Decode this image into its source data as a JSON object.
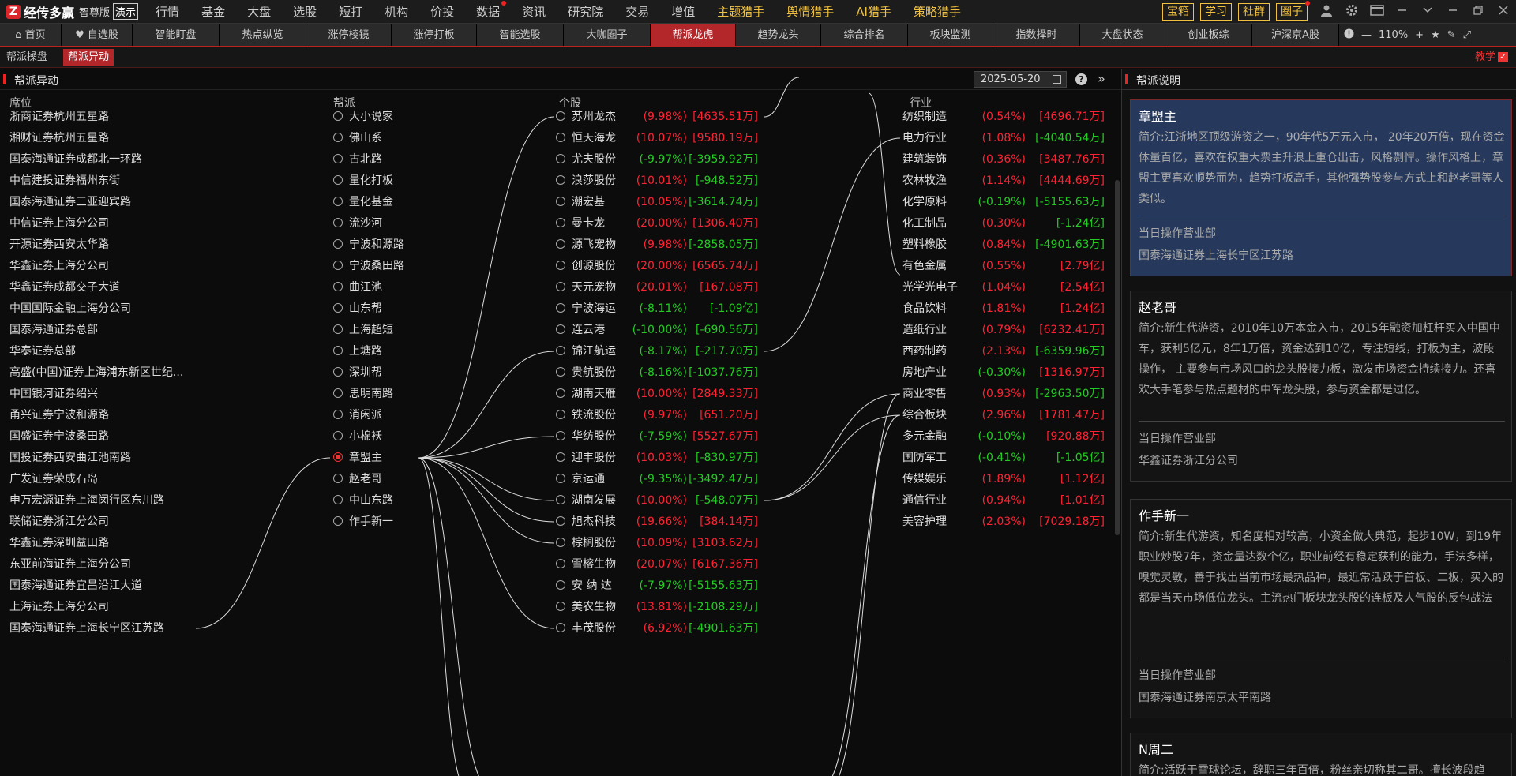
{
  "app": {
    "logo_glyph": "Z",
    "name": "经传多赢",
    "edition": "智尊版",
    "demo": "演示"
  },
  "main_nav": [
    {
      "label": "行情"
    },
    {
      "label": "基金"
    },
    {
      "label": "大盘"
    },
    {
      "label": "选股"
    },
    {
      "label": "短打"
    },
    {
      "label": "机构"
    },
    {
      "label": "价投"
    },
    {
      "label": "数据",
      "dot": true
    },
    {
      "label": "资讯"
    },
    {
      "label": "研究院"
    },
    {
      "label": "交易"
    },
    {
      "label": "增值"
    },
    {
      "label": "主题猎手",
      "hl": true
    },
    {
      "label": "舆情猎手",
      "hl": true
    },
    {
      "label": "AI猎手",
      "hl": true
    },
    {
      "label": "策略猎手",
      "hl": true
    }
  ],
  "toolbar": {
    "buttons": [
      "宝箱",
      "学习",
      "社群",
      "圈子"
    ],
    "icons": [
      "user-icon",
      "gear-icon",
      "window-icon",
      "minimize-icon",
      "collapse-icon",
      "restore-icon",
      "close-icon"
    ]
  },
  "tabs": [
    {
      "label": "⌂ 首页",
      "w": 78
    },
    {
      "label": "♥ 自选股",
      "w": 90
    },
    {
      "label": "智能盯盘",
      "w": 110
    },
    {
      "label": "热点纵览",
      "w": 110
    },
    {
      "label": "涨停棱镜",
      "w": 108
    },
    {
      "label": "涨停打板",
      "w": 108
    },
    {
      "label": "智能选股",
      "w": 110
    },
    {
      "label": "大咖圈子",
      "w": 110
    },
    {
      "label": "帮派龙虎",
      "w": 108,
      "active": true
    },
    {
      "label": "趋势龙头",
      "w": 108
    },
    {
      "label": "综合排名",
      "w": 110
    },
    {
      "label": "板块监测",
      "w": 108
    },
    {
      "label": "指数择时",
      "w": 110
    },
    {
      "label": "大盘状态",
      "w": 108
    },
    {
      "label": "创业板综",
      "w": 110
    },
    {
      "label": "沪深京A股",
      "w": 110
    }
  ],
  "zoom": {
    "value": "110%"
  },
  "subtabs": [
    {
      "label": "帮派操盘"
    },
    {
      "label": "帮派异动",
      "active": true
    }
  ],
  "teach": {
    "label": "教学"
  },
  "left_panel": {
    "title": "帮派异动",
    "date": "2025-05-20",
    "columns": {
      "seat": "席位",
      "gang": "帮派",
      "stock": "个股",
      "industry": "行业"
    }
  },
  "seats": [
    "浙商证券杭州五星路",
    "湘财证券杭州五星路",
    "国泰海通证券成都北一环路",
    "中信建投证券福州东街",
    "国泰海通证券三亚迎宾路",
    "中信证券上海分公司",
    "开源证券西安太华路",
    "华鑫证券上海分公司",
    "华鑫证券成都交子大道",
    "中国国际金融上海分公司",
    "国泰海通证券总部",
    "华泰证券总部",
    "高盛(中国)证券上海浦东新区世纪...",
    "中国银河证券绍兴",
    "甬兴证券宁波和源路",
    "国盛证券宁波桑田路",
    "国投证券西安曲江池南路",
    "广发证券荣成石岛",
    "申万宏源证券上海闵行区东川路",
    "联储证券浙江分公司",
    "华鑫证券深圳益田路",
    "东亚前海证券上海分公司",
    "国泰海通证券宜昌沿江大道",
    "上海证券上海分公司",
    "国泰海通证券上海长宁区江苏路"
  ],
  "gangs": [
    {
      "name": "大小说家"
    },
    {
      "name": "佛山系"
    },
    {
      "name": "古北路"
    },
    {
      "name": "量化打板"
    },
    {
      "name": "量化基金"
    },
    {
      "name": "流沙河"
    },
    {
      "name": "宁波和源路"
    },
    {
      "name": "宁波桑田路"
    },
    {
      "name": "曲江池"
    },
    {
      "name": "山东帮"
    },
    {
      "name": "上海超短"
    },
    {
      "name": "上塘路"
    },
    {
      "name": "深圳帮"
    },
    {
      "name": "思明南路"
    },
    {
      "name": "消闲派"
    },
    {
      "name": "小棉袄"
    },
    {
      "name": "章盟主",
      "selected": true
    },
    {
      "name": "赵老哥"
    },
    {
      "name": "中山东路"
    },
    {
      "name": "作手新一"
    }
  ],
  "stocks": [
    {
      "name": "苏州龙杰",
      "pct": "(9.98%)",
      "amt": "[4635.51万]",
      "pdir": "up",
      "adir": "up"
    },
    {
      "name": "恒天海龙",
      "pct": "(10.07%)",
      "amt": "[9580.19万]",
      "pdir": "up",
      "adir": "up"
    },
    {
      "name": "尤夫股份",
      "pct": "(-9.97%)",
      "amt": "[-3959.92万]",
      "pdir": "dn",
      "adir": "dn"
    },
    {
      "name": "浪莎股份",
      "pct": "(10.01%)",
      "amt": "[-948.52万]",
      "pdir": "up",
      "adir": "dn"
    },
    {
      "name": "潮宏基",
      "pct": "(10.05%)",
      "amt": "[-3614.74万]",
      "pdir": "up",
      "adir": "dn"
    },
    {
      "name": "曼卡龙",
      "pct": "(20.00%)",
      "amt": "[1306.40万]",
      "pdir": "up",
      "adir": "up"
    },
    {
      "name": "源飞宠物",
      "pct": "(9.98%)",
      "amt": "[-2858.05万]",
      "pdir": "up",
      "adir": "dn"
    },
    {
      "name": "创源股份",
      "pct": "(20.00%)",
      "amt": "[6565.74万]",
      "pdir": "up",
      "adir": "up"
    },
    {
      "name": "天元宠物",
      "pct": "(20.01%)",
      "amt": "[167.08万]",
      "pdir": "up",
      "adir": "up"
    },
    {
      "name": "宁波海运",
      "pct": "(-8.11%)",
      "amt": "[-1.09亿]",
      "pdir": "dn",
      "adir": "dn"
    },
    {
      "name": "连云港",
      "pct": "(-10.00%)",
      "amt": "[-690.56万]",
      "pdir": "dn",
      "adir": "dn"
    },
    {
      "name": "锦江航运",
      "pct": "(-8.17%)",
      "amt": "[-217.70万]",
      "pdir": "dn",
      "adir": "dn"
    },
    {
      "name": "贵航股份",
      "pct": "(-8.16%)",
      "amt": "[-1037.76万]",
      "pdir": "dn",
      "adir": "dn"
    },
    {
      "name": "湖南天雁",
      "pct": "(10.00%)",
      "amt": "[2849.33万]",
      "pdir": "up",
      "adir": "up"
    },
    {
      "name": "铁流股份",
      "pct": "(9.97%)",
      "amt": "[651.20万]",
      "pdir": "up",
      "adir": "up"
    },
    {
      "name": "华纺股份",
      "pct": "(-7.59%)",
      "amt": "[5527.67万]",
      "pdir": "dn",
      "adir": "up"
    },
    {
      "name": "迎丰股份",
      "pct": "(10.03%)",
      "amt": "[-830.97万]",
      "pdir": "up",
      "adir": "dn"
    },
    {
      "name": "京运通",
      "pct": "(-9.35%)",
      "amt": "[-3492.47万]",
      "pdir": "dn",
      "adir": "dn"
    },
    {
      "name": "湖南发展",
      "pct": "(10.00%)",
      "amt": "[-548.07万]",
      "pdir": "up",
      "adir": "dn"
    },
    {
      "name": "旭杰科技",
      "pct": "(19.66%)",
      "amt": "[384.14万]",
      "pdir": "up",
      "adir": "up"
    },
    {
      "name": "棕榈股份",
      "pct": "(10.09%)",
      "amt": "[3103.62万]",
      "pdir": "up",
      "adir": "up"
    },
    {
      "name": "雪榕生物",
      "pct": "(20.07%)",
      "amt": "[6167.36万]",
      "pdir": "up",
      "adir": "up"
    },
    {
      "name": "安 纳 达",
      "pct": "(-7.97%)",
      "amt": "[-5155.63万]",
      "pdir": "dn",
      "adir": "dn"
    },
    {
      "name": "美农生物",
      "pct": "(13.81%)",
      "amt": "[-2108.29万]",
      "pdir": "up",
      "adir": "dn"
    },
    {
      "name": "丰茂股份",
      "pct": "(6.92%)",
      "amt": "[-4901.63万]",
      "pdir": "up",
      "adir": "dn"
    }
  ],
  "industries": [
    {
      "name": "纺织制造",
      "pct": "(0.54%)",
      "amt": "[4696.71万]",
      "pdir": "up",
      "adir": "up"
    },
    {
      "name": "电力行业",
      "pct": "(1.08%)",
      "amt": "[-4040.54万]",
      "pdir": "up",
      "adir": "dn"
    },
    {
      "name": "建筑装饰",
      "pct": "(0.36%)",
      "amt": "[3487.76万]",
      "pdir": "up",
      "adir": "up"
    },
    {
      "name": "农林牧渔",
      "pct": "(1.14%)",
      "amt": "[4444.69万]",
      "pdir": "up",
      "adir": "up"
    },
    {
      "name": "化学原料",
      "pct": "(-0.19%)",
      "amt": "[-5155.63万]",
      "pdir": "dn",
      "adir": "dn"
    },
    {
      "name": "化工制品",
      "pct": "(0.30%)",
      "amt": "[-1.24亿]",
      "pdir": "up",
      "adir": "dn"
    },
    {
      "name": "塑料橡胶",
      "pct": "(0.84%)",
      "amt": "[-4901.63万]",
      "pdir": "up",
      "adir": "dn"
    },
    {
      "name": "有色金属",
      "pct": "(0.55%)",
      "amt": "[2.79亿]",
      "pdir": "up",
      "adir": "up"
    },
    {
      "name": "光学光电子",
      "pct": "(1.04%)",
      "amt": "[2.54亿]",
      "pdir": "up",
      "adir": "up"
    },
    {
      "name": "食品饮料",
      "pct": "(1.81%)",
      "amt": "[1.24亿]",
      "pdir": "up",
      "adir": "up"
    },
    {
      "name": "造纸行业",
      "pct": "(0.79%)",
      "amt": "[6232.41万]",
      "pdir": "up",
      "adir": "up"
    },
    {
      "name": "西药制药",
      "pct": "(2.13%)",
      "amt": "[-6359.96万]",
      "pdir": "up",
      "adir": "dn"
    },
    {
      "name": "房地产业",
      "pct": "(-0.30%)",
      "amt": "[1316.97万]",
      "pdir": "dn",
      "adir": "up"
    },
    {
      "name": "商业零售",
      "pct": "(0.93%)",
      "amt": "[-2963.50万]",
      "pdir": "up",
      "adir": "dn"
    },
    {
      "name": "综合板块",
      "pct": "(2.96%)",
      "amt": "[1781.47万]",
      "pdir": "up",
      "adir": "up"
    },
    {
      "name": "多元金融",
      "pct": "(-0.10%)",
      "amt": "[920.88万]",
      "pdir": "dn",
      "adir": "up"
    },
    {
      "name": "国防军工",
      "pct": "(-0.41%)",
      "amt": "[-1.05亿]",
      "pdir": "dn",
      "adir": "dn"
    },
    {
      "name": "传媒娱乐",
      "pct": "(1.89%)",
      "amt": "[1.12亿]",
      "pdir": "up",
      "adir": "up"
    },
    {
      "name": "通信行业",
      "pct": "(0.94%)",
      "amt": "[1.01亿]",
      "pdir": "up",
      "adir": "up"
    },
    {
      "name": "美容护理",
      "pct": "(2.03%)",
      "amt": "[7029.18万]",
      "pdir": "up",
      "adir": "up"
    }
  ],
  "links": {
    "seat_to_gang": [
      [
        24,
        16
      ]
    ],
    "gang_to_stock": [
      [
        16,
        0
      ],
      [
        16,
        11
      ],
      [
        16,
        15
      ],
      [
        16,
        18
      ],
      [
        16,
        19
      ],
      [
        16,
        20
      ],
      [
        16,
        24
      ]
    ],
    "stock_to_industry": [
      [
        0,
        -1
      ],
      [
        11,
        1
      ],
      [
        18,
        13
      ],
      [
        18,
        14
      ]
    ]
  },
  "right_panel": {
    "title": "帮派说明",
    "cards": [
      {
        "name": "章盟主",
        "selected": true,
        "intro": "简介:江浙地区顶级游资之一，90年代5万元入市， 20年20万倍，现在资金体量百亿，喜欢在权重大票主升浪上重仓出击，风格剽悍。操作风格上，章盟主更喜欢顺势而为，趋势打板高手，其他强势股参与方式上和赵老哥等人类似。",
        "dept_label": "当日操作营业部",
        "dept": "国泰海通证券上海长宁区江苏路"
      },
      {
        "name": "赵老哥",
        "intro": "简介:新生代游资，2010年10万本金入市，2015年融资加杠杆买入中国中车，获利5亿元，8年1万倍，资金达到10亿，专注短线，打板为主，波段操作， 主要参与市场风口的龙头股接力板，激发市场资金持续接力。还喜欢大手笔参与热点题材的中军龙头股，参与资金都是过亿。",
        "dept_label": "当日操作营业部",
        "dept": "华鑫证券浙江分公司"
      },
      {
        "name": "作手新一",
        "intro": "简介:新生代游资，知名度相对较高，小资金做大典范，起步10W，到19年职业炒股7年，资金量达数个亿，职业前经有稳定获利的能力，手法多样，嗅觉灵敏，善于找出当前市场最热品种，最近常活跃于首板、二板，买入的都是当天市场低位龙头。主流热门板块龙头股的连板及人气股的反包战法",
        "dept_label": "当日操作营业部",
        "dept": "国泰海通证券南京太平南路"
      },
      {
        "name": "N周二",
        "intro": "简介:活跃于雪球论坛，辞职三年百倍，粉丝亲切称其二哥。擅长波段趋势、看长做短。大格局，个股彻底走坏才考虑出局。",
        "dept_label": "",
        "dept": ""
      }
    ]
  }
}
